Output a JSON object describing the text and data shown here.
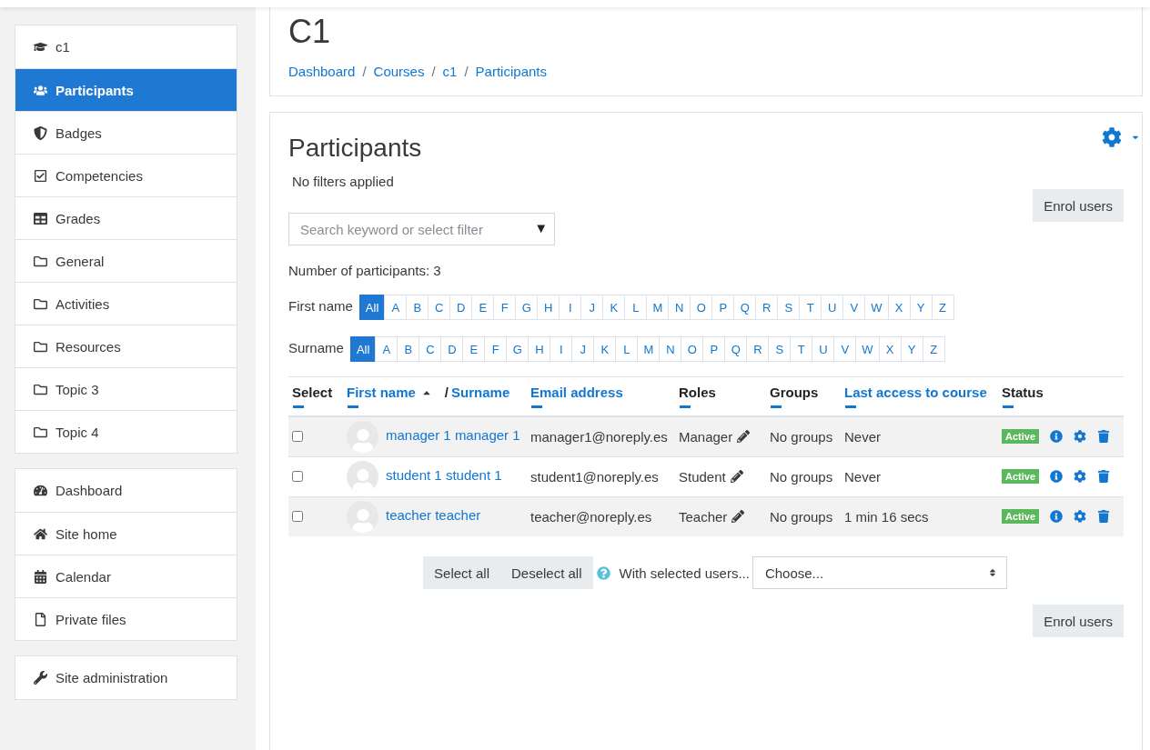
{
  "sidebar": {
    "groups": [
      {
        "items": [
          {
            "kind": "course",
            "label": "c1",
            "selected": false
          },
          {
            "kind": "people",
            "label": "Participants",
            "selected": true
          },
          {
            "kind": "badge",
            "label": "Badges",
            "selected": false
          },
          {
            "kind": "competency",
            "label": "Competencies",
            "selected": false
          },
          {
            "kind": "grades",
            "label": "Grades",
            "selected": false
          },
          {
            "kind": "folder",
            "label": "General",
            "selected": false
          },
          {
            "kind": "folder",
            "label": "Activities",
            "selected": false
          },
          {
            "kind": "folder",
            "label": "Resources",
            "selected": false
          },
          {
            "kind": "folder",
            "label": "Topic 3",
            "selected": false
          },
          {
            "kind": "folder",
            "label": "Topic 4",
            "selected": false
          }
        ]
      },
      {
        "items": [
          {
            "kind": "dashboard",
            "label": "Dashboard",
            "selected": false
          },
          {
            "kind": "home",
            "label": "Site home",
            "selected": false
          },
          {
            "kind": "calendar",
            "label": "Calendar",
            "selected": false
          },
          {
            "kind": "file",
            "label": "Private files",
            "selected": false
          }
        ]
      },
      {
        "items": [
          {
            "kind": "admin",
            "label": "Site administration",
            "selected": false
          }
        ]
      }
    ]
  },
  "header": {
    "title": "C1",
    "breadcrumb": [
      "Dashboard",
      "Courses",
      "c1",
      "Participants"
    ],
    "separator": "/"
  },
  "participants": {
    "title": "Participants",
    "filters_note": "No filters applied",
    "enrol_button": "Enrol users",
    "search": {
      "placeholder": "Search keyword or select filter",
      "arrow": "▼"
    },
    "count": "Number of participants: 3",
    "initials_bars": [
      {
        "label": "First name",
        "letters": [
          {
            "text": "All",
            "selected": true
          },
          {
            "text": "A",
            "selected": false
          },
          {
            "text": "B",
            "selected": false
          },
          {
            "text": "C",
            "selected": false
          },
          {
            "text": "D",
            "selected": false
          },
          {
            "text": "E",
            "selected": false
          },
          {
            "text": "F",
            "selected": false
          },
          {
            "text": "G",
            "selected": false
          },
          {
            "text": "H",
            "selected": false
          },
          {
            "text": "I",
            "selected": false
          },
          {
            "text": "J",
            "selected": false
          },
          {
            "text": "K",
            "selected": false
          },
          {
            "text": "L",
            "selected": false
          },
          {
            "text": "M",
            "selected": false
          },
          {
            "text": "N",
            "selected": false
          },
          {
            "text": "O",
            "selected": false
          },
          {
            "text": "P",
            "selected": false
          },
          {
            "text": "Q",
            "selected": false
          },
          {
            "text": "R",
            "selected": false
          },
          {
            "text": "S",
            "selected": false
          },
          {
            "text": "T",
            "selected": false
          },
          {
            "text": "U",
            "selected": false
          },
          {
            "text": "V",
            "selected": false
          },
          {
            "text": "W",
            "selected": false
          },
          {
            "text": "X",
            "selected": false
          },
          {
            "text": "Y",
            "selected": false
          },
          {
            "text": "Z",
            "selected": false
          }
        ]
      },
      {
        "label": "Surname",
        "letters": [
          {
            "text": "All",
            "selected": true
          },
          {
            "text": "A",
            "selected": false
          },
          {
            "text": "B",
            "selected": false
          },
          {
            "text": "C",
            "selected": false
          },
          {
            "text": "D",
            "selected": false
          },
          {
            "text": "E",
            "selected": false
          },
          {
            "text": "F",
            "selected": false
          },
          {
            "text": "G",
            "selected": false
          },
          {
            "text": "H",
            "selected": false
          },
          {
            "text": "I",
            "selected": false
          },
          {
            "text": "J",
            "selected": false
          },
          {
            "text": "K",
            "selected": false
          },
          {
            "text": "L",
            "selected": false
          },
          {
            "text": "M",
            "selected": false
          },
          {
            "text": "N",
            "selected": false
          },
          {
            "text": "O",
            "selected": false
          },
          {
            "text": "P",
            "selected": false
          },
          {
            "text": "Q",
            "selected": false
          },
          {
            "text": "R",
            "selected": false
          },
          {
            "text": "S",
            "selected": false
          },
          {
            "text": "T",
            "selected": false
          },
          {
            "text": "U",
            "selected": false
          },
          {
            "text": "V",
            "selected": false
          },
          {
            "text": "W",
            "selected": false
          },
          {
            "text": "X",
            "selected": false
          },
          {
            "text": "Y",
            "selected": false
          },
          {
            "text": "Z",
            "selected": false
          }
        ]
      }
    ],
    "table": {
      "columns": [
        {
          "kind": "plain",
          "label": "Select",
          "sorted": false
        },
        {
          "kind": "name",
          "label": "First name",
          "sorted": true,
          "separator": "/",
          "second_label": "Surname"
        },
        {
          "kind": "link",
          "label": "Email address",
          "sorted": false
        },
        {
          "kind": "plain",
          "label": "Roles",
          "sorted": false
        },
        {
          "kind": "plain",
          "label": "Groups",
          "sorted": false
        },
        {
          "kind": "link",
          "label": "Last access to course",
          "sorted": false
        },
        {
          "kind": "plain",
          "label": "Status",
          "sorted": false
        }
      ],
      "rows": [
        {
          "checked": false,
          "name": "manager 1 manager 1",
          "email": "manager1@noreply.es",
          "role": "Manager",
          "groups": "No groups",
          "last_access": "Never",
          "status": "Active"
        },
        {
          "checked": false,
          "name": "student 1 student 1",
          "email": "student1@noreply.es",
          "role": "Student",
          "groups": "No groups",
          "last_access": "Never",
          "status": "Active"
        },
        {
          "checked": false,
          "name": "teacher teacher",
          "email": "teacher@noreply.es",
          "role": "Teacher",
          "groups": "No groups",
          "last_access": "1 min 16 secs",
          "status": "Active"
        }
      ]
    },
    "bulk": {
      "select_all": "Select all",
      "deselect_all": "Deselect all",
      "label": "With selected users...",
      "choose": "Choose..."
    },
    "enrol_button_bottom": "Enrol users"
  }
}
